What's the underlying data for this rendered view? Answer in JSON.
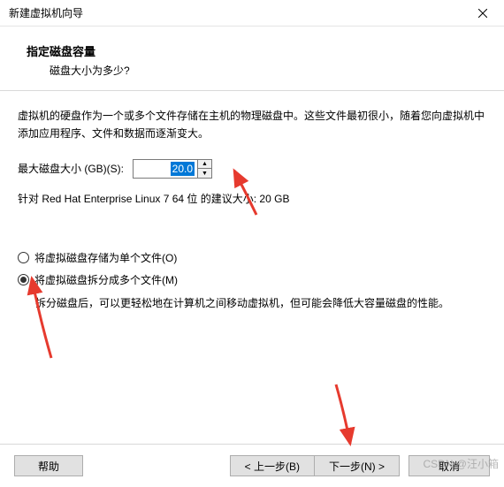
{
  "window": {
    "title": "新建虚拟机向导"
  },
  "header": {
    "title": "指定磁盘容量",
    "subtitle": "磁盘大小为多少?"
  },
  "body": {
    "description": "虚拟机的硬盘作为一个或多个文件存储在主机的物理磁盘中。这些文件最初很小，随着您向虚拟机中添加应用程序、文件和数据而逐渐变大。",
    "size_label": "最大磁盘大小 (GB)(S):",
    "size_value": "20.0",
    "recommend": "针对 Red Hat Enterprise Linux 7 64 位 的建议大小: 20 GB",
    "radio_single": "将虚拟磁盘存储为单个文件(O)",
    "radio_split": "将虚拟磁盘拆分成多个文件(M)",
    "split_desc": "拆分磁盘后，可以更轻松地在计算机之间移动虚拟机，但可能会降低大容量磁盘的性能。"
  },
  "footer": {
    "help": "帮助",
    "back": "< 上一步(B)",
    "next": "下一步(N) >",
    "cancel": "取消"
  },
  "watermark": "CSDN @汪小箱"
}
